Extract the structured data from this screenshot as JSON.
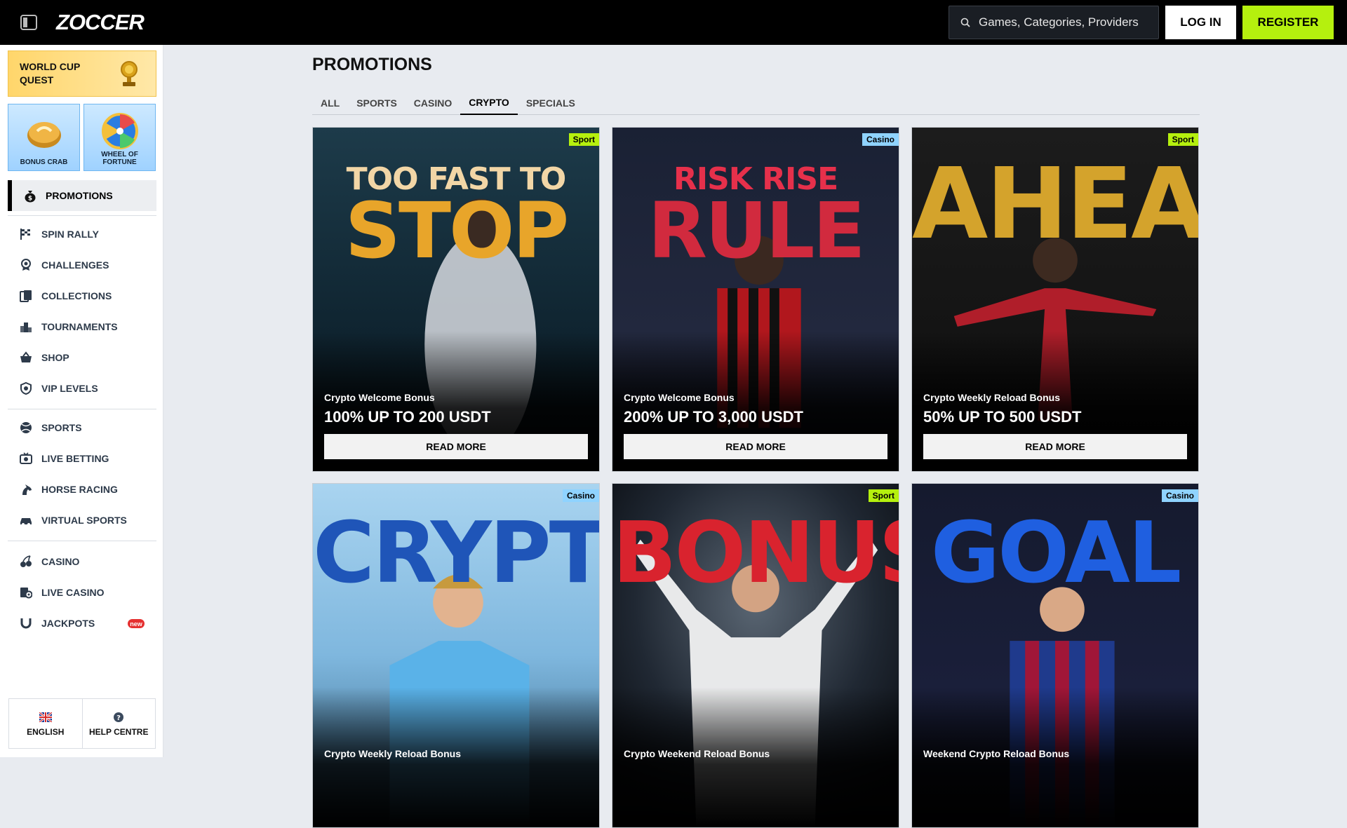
{
  "header": {
    "logo_text": "ZOCCER",
    "search_placeholder": "Games, Categories, Providers",
    "login_label": "LOG IN",
    "register_label": "REGISTER"
  },
  "sidebar": {
    "quest_label": "WORLD CUP\nQUEST",
    "tiles": [
      {
        "label": "BONUS CRAB"
      },
      {
        "label": "WHEEL OF FORTUNE"
      }
    ],
    "active_item": "PROMOTIONS",
    "groups": [
      [
        {
          "label": "SPIN RALLY",
          "icon": "checkered-flag-icon"
        },
        {
          "label": "CHALLENGES",
          "icon": "medal-icon"
        },
        {
          "label": "COLLECTIONS",
          "icon": "cards-icon"
        },
        {
          "label": "TOURNAMENTS",
          "icon": "podium-icon"
        },
        {
          "label": "SHOP",
          "icon": "basket-icon"
        },
        {
          "label": "VIP LEVELS",
          "icon": "shield-icon"
        }
      ],
      [
        {
          "label": "SPORTS",
          "icon": "ball-icon"
        },
        {
          "label": "LIVE BETTING",
          "icon": "live-tv-icon"
        },
        {
          "label": "HORSE RACING",
          "icon": "horse-icon"
        },
        {
          "label": "VIRTUAL SPORTS",
          "icon": "car-icon"
        }
      ],
      [
        {
          "label": "CASINO",
          "icon": "cherries-icon"
        },
        {
          "label": "LIVE CASINO",
          "icon": "live-cards-icon"
        },
        {
          "label": "JACKPOTS",
          "icon": "horseshoe-icon",
          "badge": "new"
        }
      ]
    ],
    "footer": {
      "language_label": "ENGLISH",
      "help_label": "HELP CENTRE"
    }
  },
  "main": {
    "title": "PROMOTIONS",
    "tabs": [
      "ALL",
      "SPORTS",
      "CASINO",
      "CRYPTO",
      "SPECIALS"
    ],
    "active_tab": "CRYPTO",
    "cards": [
      {
        "tag": "Sport",
        "headline_top": "TOO FAST TO",
        "headline": "STOP",
        "title": "Crypto Welcome Bonus",
        "value": "100% UP TO 200 USDT",
        "button": "READ MORE"
      },
      {
        "tag": "Casino",
        "headline_top": "RISK RISE",
        "headline": "RULE",
        "title": "Crypto Welcome Bonus",
        "value": "200% UP TO 3,000 USDT",
        "button": "READ MORE"
      },
      {
        "tag": "Sport",
        "headline_top": "",
        "headline": "AHEAD",
        "title": "Crypto Weekly Reload Bonus",
        "value": "50% UP TO 500 USDT",
        "button": "READ MORE"
      },
      {
        "tag": "Casino",
        "headline_top": "",
        "headline": "CRYPTO",
        "title": "Crypto Weekly Reload Bonus",
        "value": "",
        "button": ""
      },
      {
        "tag": "Sport",
        "headline_top": "",
        "headline": "BONUS",
        "title": "Crypto Weekend Reload Bonus",
        "value": "",
        "button": ""
      },
      {
        "tag": "Casino",
        "headline_top": "",
        "headline": "GOAL",
        "title": "Weekend Crypto Reload Bonus",
        "value": "",
        "button": ""
      }
    ]
  },
  "colors": {
    "accent_green": "#b5f00e",
    "casino_blue": "#8fd3ff",
    "header_bg": "#000000"
  }
}
